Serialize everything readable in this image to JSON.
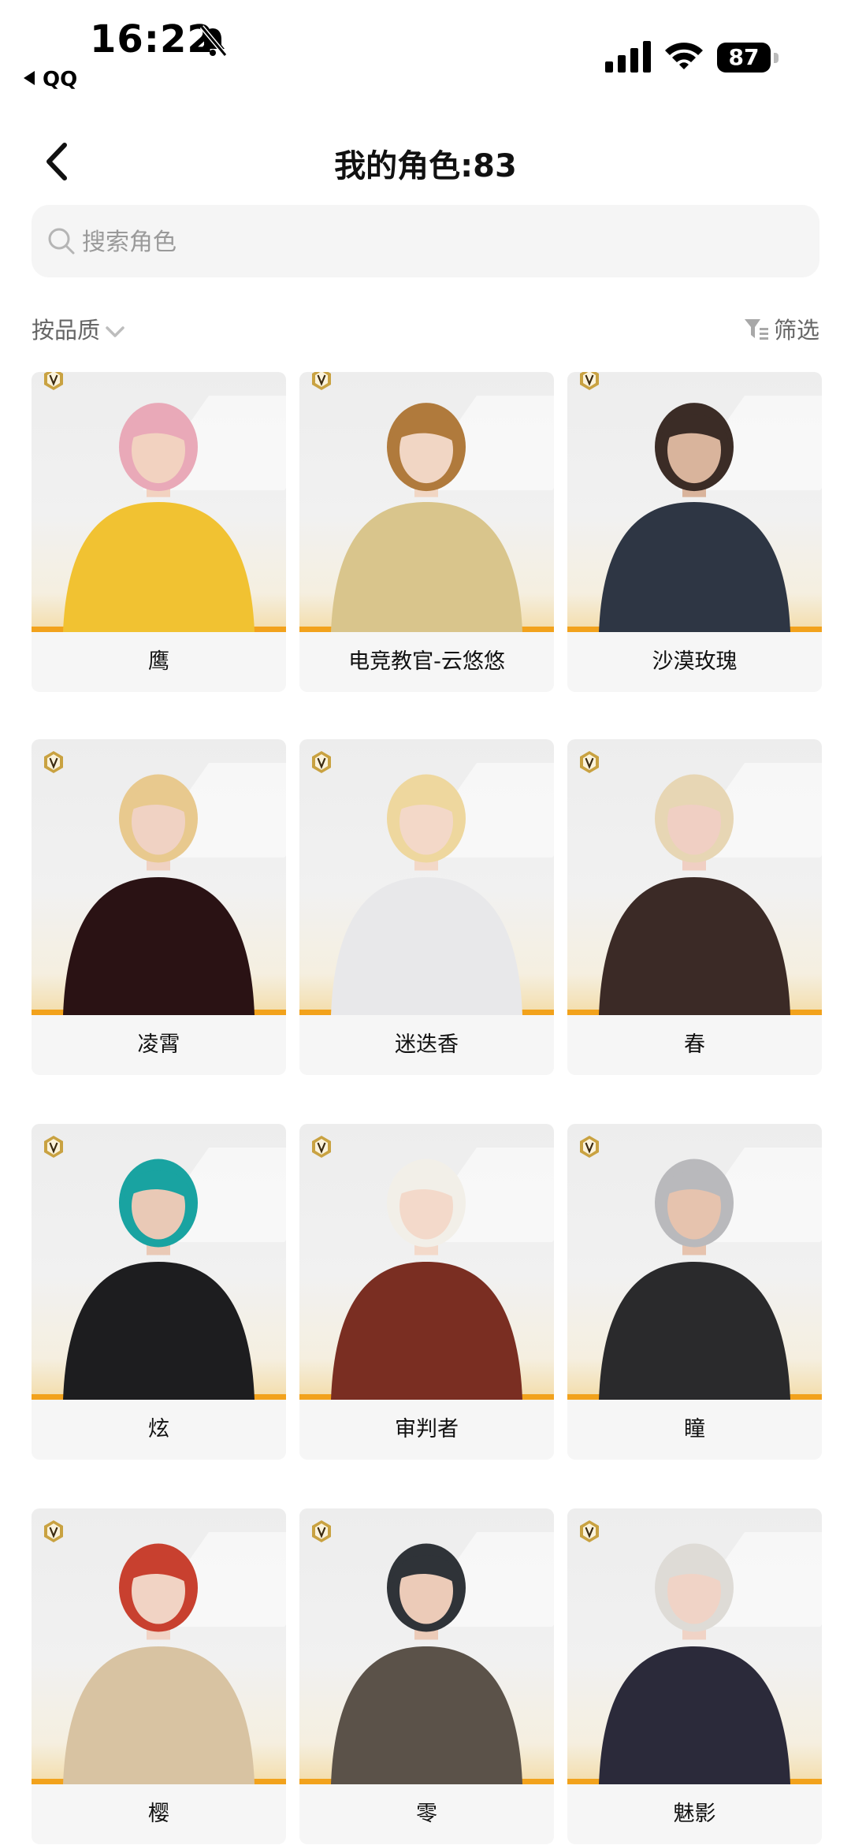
{
  "status_bar": {
    "time": "16:22",
    "back_app": "QQ",
    "battery": "87"
  },
  "header": {
    "title": "我的角色:83"
  },
  "search": {
    "placeholder": "搜索角色",
    "value": ""
  },
  "toolbar": {
    "sort_label": "按品质",
    "filter_label": "筛选"
  },
  "colors": {
    "accent": "#f2a21c",
    "badge_gold": "#c9a241"
  },
  "characters": [
    {
      "name": "鹰",
      "hair": "#e9a9b8",
      "outfit": "#f1c232",
      "skin": "#f2d2c0"
    },
    {
      "name": "电竞教官-云悠悠",
      "hair": "#b07a3c",
      "outfit": "#d9c58c",
      "skin": "#f1d6c4"
    },
    {
      "name": "沙漠玫瑰",
      "hair": "#3b2c26",
      "outfit": "#2e3644",
      "skin": "#d9b49c"
    },
    {
      "name": "凌霄",
      "hair": "#e8c98e",
      "outfit": "#2a1214",
      "skin": "#f0d2c3"
    },
    {
      "name": "迷迭香",
      "hair": "#eed79e",
      "outfit": "#e8e8ea",
      "skin": "#f3d8c8"
    },
    {
      "name": "春",
      "hair": "#e7d6b4",
      "outfit": "#3b2a26",
      "skin": "#f0cfc3"
    },
    {
      "name": "炫",
      "hair": "#19a3a1",
      "outfit": "#1d1d1f",
      "skin": "#e9c9b6"
    },
    {
      "name": "审判者",
      "hair": "#f2efe8",
      "outfit": "#7a2e22",
      "skin": "#f3d9ca"
    },
    {
      "name": "瞳",
      "hair": "#b9b9bc",
      "outfit": "#2a2a2c",
      "skin": "#e6c3ae"
    },
    {
      "name": "樱",
      "hair": "#c8402f",
      "outfit": "#d8c3a2",
      "skin": "#f1d3c4"
    },
    {
      "name": "零",
      "hair": "#2f3338",
      "outfit": "#5b5249",
      "skin": "#eccbb8"
    },
    {
      "name": "魅影",
      "hair": "#dedbd6",
      "outfit": "#2b2a3a",
      "skin": "#f0d3c6"
    }
  ]
}
